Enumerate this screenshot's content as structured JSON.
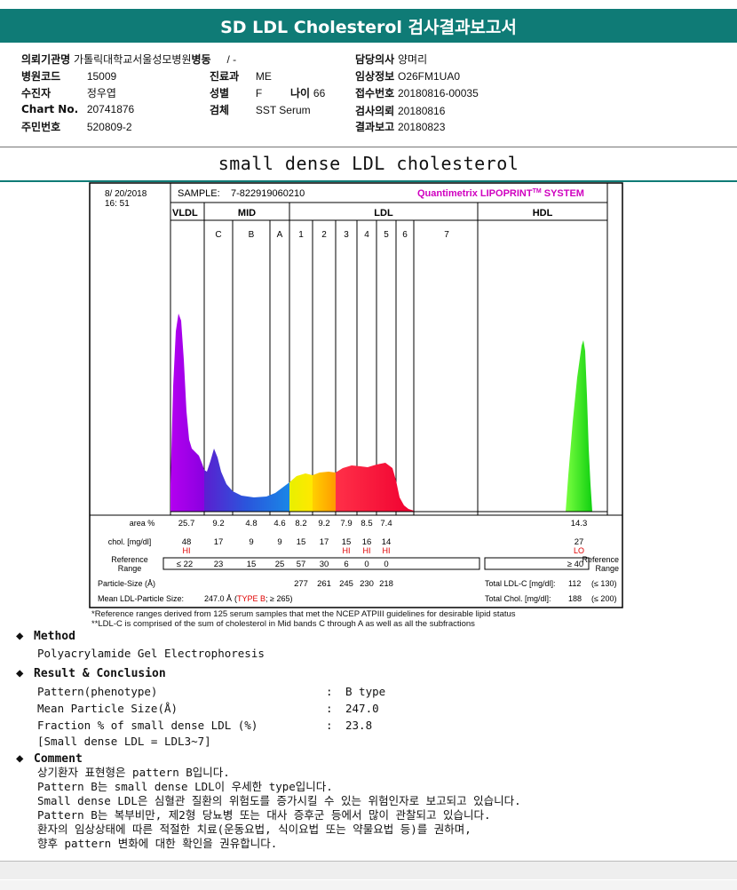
{
  "header": {
    "title": "SD LDL Cholesterol 검사결과보고서"
  },
  "info": {
    "requesting_institution_label": "의뢰기관명",
    "requesting_institution": "가톨릭대학교서울성모병원",
    "ward_label": "병동",
    "ward": "/ -",
    "doctor_label": "담당의사",
    "doctor": "양며리",
    "hospital_code_label": "병원코드",
    "hospital_code": "15009",
    "department_label": "진료과",
    "department": "ME",
    "clinical_info_label": "임상정보",
    "clinical_info": "O26FM1UA0",
    "patient_label": "수진자",
    "patient": "정우엽",
    "sex_label": "성별",
    "sex": "F",
    "age_label": "나이",
    "age": "66",
    "receipt_no_label": "접수번호",
    "receipt_no": "20180816-00035",
    "chart_no_label": "Chart No.",
    "chart_no": "20741876",
    "specimen_label": "검체",
    "specimen": "SST Serum",
    "request_date_label": "검사의뢰",
    "request_date": "20180816",
    "id_label": "주민번호",
    "id": "520809-2",
    "report_date_label": "결과보고",
    "report_date": "20180823"
  },
  "subtitle": "small dense LDL cholesterol",
  "report": {
    "date": "8/ 20/2018",
    "time": "16: 51",
    "sample_label": "SAMPLE:",
    "sample_id": "7-822919060210",
    "brand_main": "Quantimetrix LIPOPRINT",
    "brand_tm": "TM",
    "brand_system": " SYSTEM",
    "zones": {
      "vldl": "VLDL",
      "mid": "MID",
      "ldl": "LDL",
      "hdl": "HDL"
    },
    "bands": [
      "C",
      "B",
      "A",
      "1",
      "2",
      "3",
      "4",
      "5",
      "6",
      "7"
    ],
    "row_labels": {
      "area": "area %",
      "chol": "chol. [mg/dl]",
      "ref1": "Reference",
      "ref2": "Range",
      "psize": "Particle-Size (Å)",
      "mean": "Mean LDL-Particle Size:",
      "ref_right1": "Reference",
      "ref_right2": "Range"
    },
    "area_values": [
      "25.7",
      "9.2",
      "4.8",
      "4.6",
      "8.2",
      "9.2",
      "7.9",
      "8.5",
      "7.4",
      "14.3"
    ],
    "chol_values": [
      "48",
      "17",
      "9",
      "9",
      "15",
      "17",
      "15",
      "16",
      "14",
      "27"
    ],
    "chol_flags": [
      "HI",
      "",
      "",
      "",
      "",
      "",
      "HI",
      "HI",
      "HI",
      "LO"
    ],
    "ref_values": [
      "≤ 22",
      "23",
      "15",
      "25",
      "57",
      "30",
      "6",
      "0",
      "0"
    ],
    "hdl_ref": "≥ 40",
    "particle_sizes": [
      "277",
      "261",
      "245",
      "230",
      "218"
    ],
    "total_ldl_label": "Total LDL-C [mg/dl]:",
    "total_ldl_value": "112",
    "total_ldl_ref": "(≤ 130)",
    "total_chol_label": "Total Chol. [mg/dl]:",
    "total_chol_value": "188",
    "total_chol_ref": "(≤ 200)",
    "mean_size_value": "247.0 Å",
    "mean_type_open": "(",
    "mean_type": "TYPE B",
    "mean_type_close": "; ≥ 265)"
  },
  "notes": {
    "line1": "*Reference ranges derived from 125 serum samples that met the NCEP ATPIII guidelines for desirable lipid status",
    "line2": "**LDL-C is comprised of the sum of cholesterol in Mid bands C through A as well as all the subfractions"
  },
  "method": {
    "title": "Method",
    "text": "Polyacrylamide Gel Electrophoresis"
  },
  "result": {
    "title": "Result & Conclusion",
    "pattern_label": "Pattern(phenotype)",
    "pattern_value": "B type",
    "mean_label": "Mean Particle Size(Å)",
    "mean_value": "247.0",
    "fraction_label": "Fraction % of small dense LDL (%)",
    "fraction_value": "23.8",
    "note": "[Small dense LDL = LDL3~7]",
    "colon": ":"
  },
  "comment": {
    "title": "Comment",
    "lines": [
      "상기환자 표현형은 pattern B입니다.",
      "Pattern B는 small dense LDL이 우세한 type입니다.",
      "Small dense LDL은 심혈관 질환의 위험도를 증가시킬 수 있는 위험인자로 보고되고 있습니다.",
      "Pattern B는 복부비만, 제2형 당뇨병 또는 대사 증후군 등에서 많이 관찰되고 있습니다.",
      "환자의 임상상태에 따른 적절한 치료(운동요법, 식이요법 또는 약물요법 등)를 권하며,",
      "향후 pattern 변화에 대한 확인을 권유합니다."
    ]
  },
  "colors": {
    "header_bg": "#0f7b76",
    "vldl": "#9b00e6",
    "mid_c": "#4b20c8",
    "mid_b": "#1f5fdc",
    "mid_a": "#1a7be6",
    "ldl1": "#ffee00",
    "ldl2": "#ffb400",
    "ldl3": "#ff1d3a",
    "ldl4": "#f0002a",
    "ldl5": "#e60040",
    "hdl": "#18e018",
    "flag": "#e00000",
    "brand": "#d000c0"
  }
}
